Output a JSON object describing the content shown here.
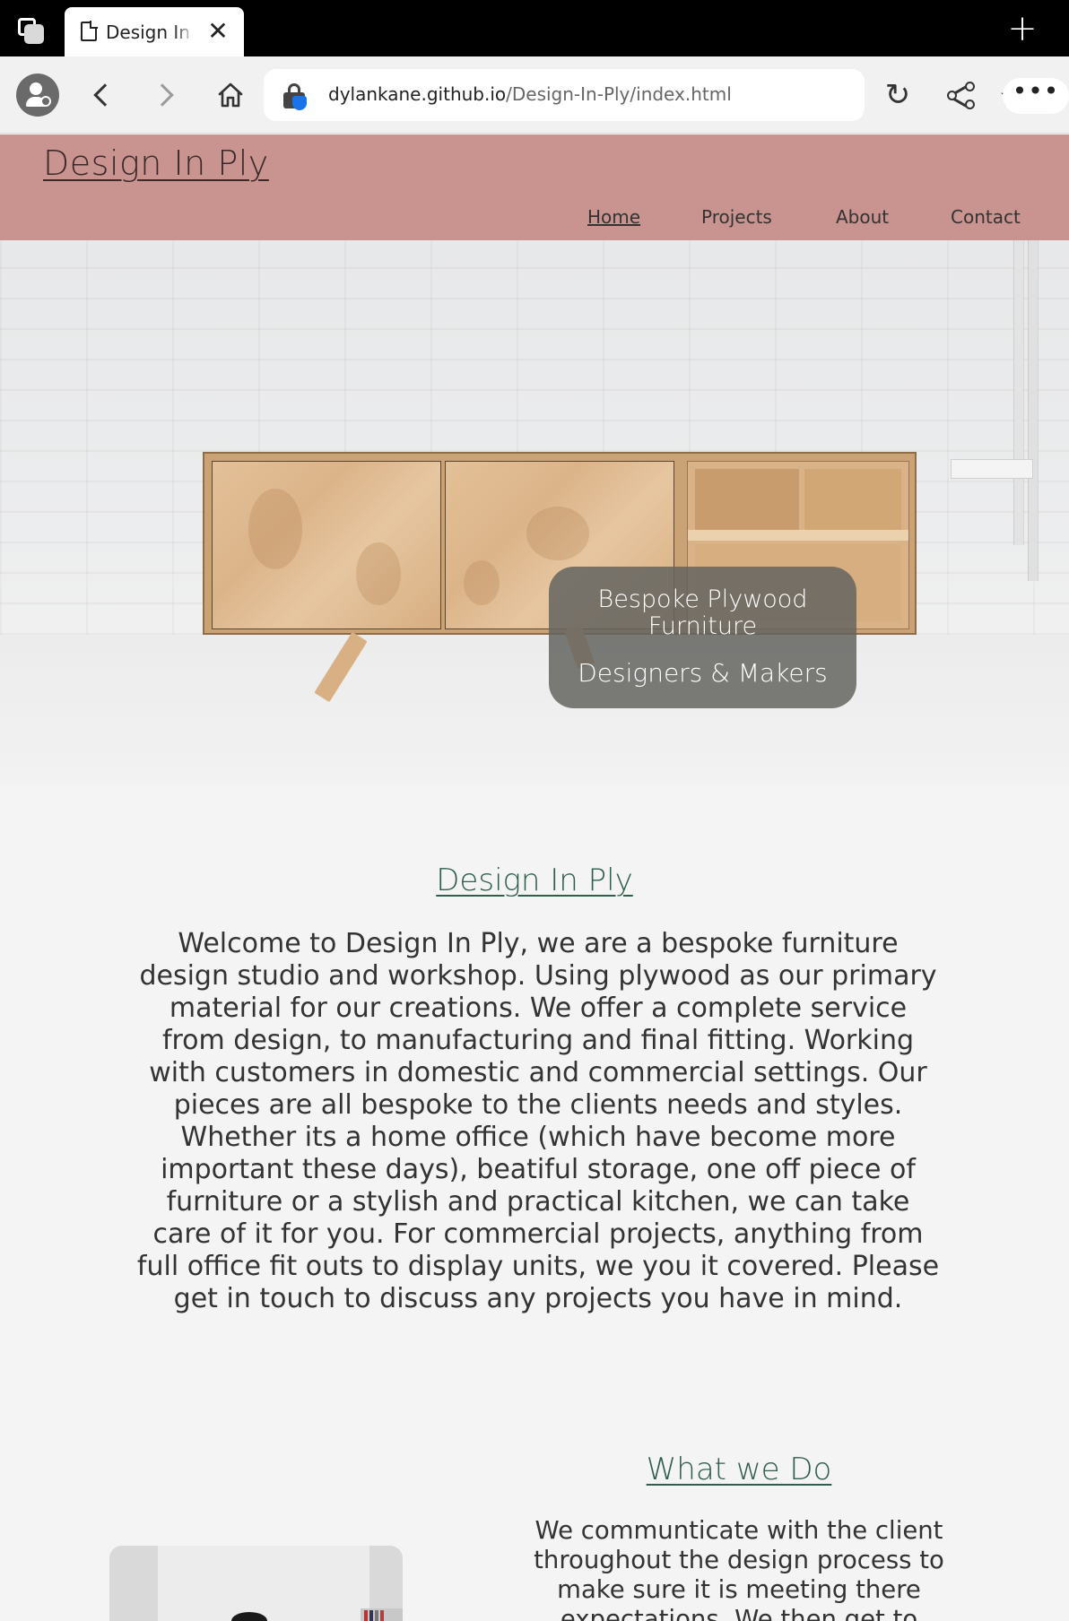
{
  "browser": {
    "tab_title": "Design In Ply",
    "close_glyph": "✕",
    "newtab_glyph": "+",
    "url_host": "dylankane.github.io",
    "url_path": "/Design-In-Ply/index.html",
    "star_glyph": "☆",
    "reload_glyph": "↻",
    "more_glyph": "•••"
  },
  "site": {
    "logo": "Design In Ply",
    "nav": [
      {
        "label": "Home",
        "active": true
      },
      {
        "label": "Projects",
        "active": false
      },
      {
        "label": "About",
        "active": false
      },
      {
        "label": "Contact",
        "active": false
      }
    ],
    "header_color": "#c9938f",
    "accent_color": "#2f5e4b"
  },
  "hero": {
    "tagline_1": "Bespoke Plywood Furniture",
    "tagline_2": "Designers & Makers"
  },
  "intro": {
    "title": "Design In Ply",
    "body": "Welcome to Design In Ply, we are a bespoke furniture design studio and workshop. Using plywood as our primary material for our creations. We offer a complete service from design, to manufacturing and final fitting. Working with customers in domestic and commercial settings. Our pieces are all bespoke to the clients needs and styles. Whether its a home office (which have become more important these days), beatiful storage, one off piece of furniture or a stylish and practical kitchen, we can take care of it for you. For commercial projects, anything from full office fit outs to display units, we you it covered. Please get in touch to discuss any projects you have in mind."
  },
  "what_we_do": {
    "title": "What we Do",
    "body": "We communticate with the client throughout the design process to make sure it is meeting there expectations. We then get to"
  }
}
